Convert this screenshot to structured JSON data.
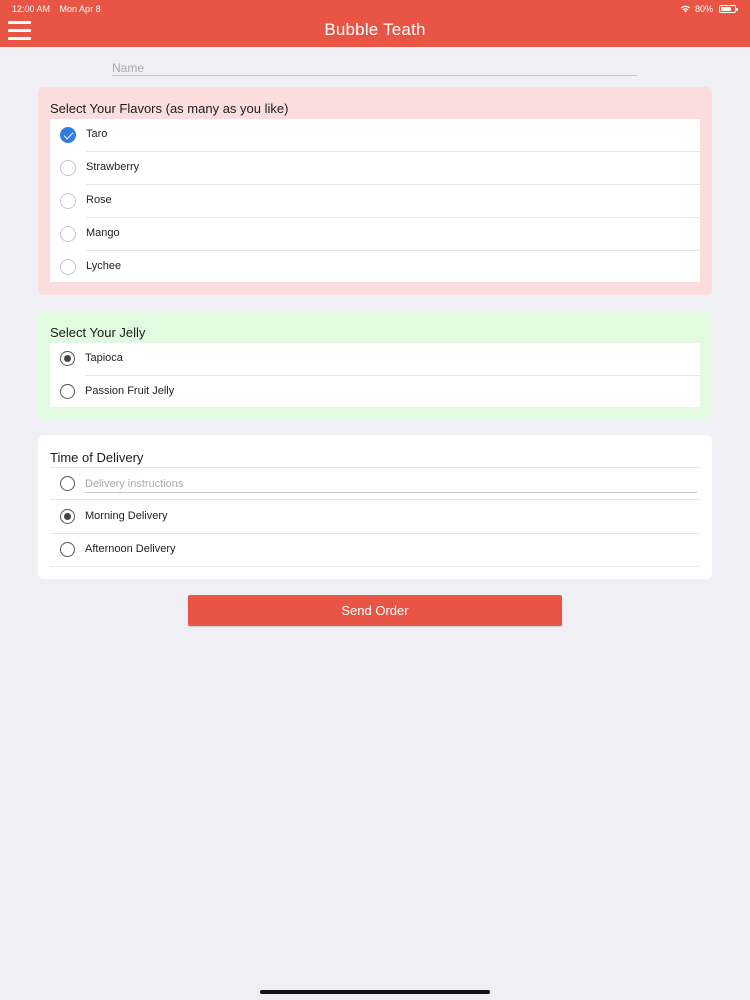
{
  "status_bar": {
    "time": "12:00 AM",
    "date": "Mon Apr 8",
    "battery": "80%"
  },
  "header": {
    "title": "Bubble Teath",
    "menu_icon": "hamburger-menu-icon",
    "color": "#e85545"
  },
  "name_field": {
    "placeholder": "Name",
    "value": ""
  },
  "flavors": {
    "title": "Select Your Flavors (as many as you like)",
    "background": "#fbdddd",
    "items": [
      {
        "label": "Taro",
        "checked": true
      },
      {
        "label": "Strawberry",
        "checked": false
      },
      {
        "label": "Rose",
        "checked": false
      },
      {
        "label": "Mango",
        "checked": false
      },
      {
        "label": "Lychee",
        "checked": false
      }
    ]
  },
  "jelly": {
    "title": "Select Your Jelly",
    "background": "#e0fbe0",
    "items": [
      {
        "label": "Tapioca",
        "selected": true
      },
      {
        "label": "Passion Fruit Jelly",
        "selected": false
      }
    ]
  },
  "delivery": {
    "title": "Time of Delivery",
    "instructions_placeholder": "Delivery instructions",
    "items": [
      {
        "label": "Morning Delivery",
        "selected": true
      },
      {
        "label": "Afternoon Delivery",
        "selected": false
      }
    ]
  },
  "send_button": {
    "label": "Send Order"
  }
}
